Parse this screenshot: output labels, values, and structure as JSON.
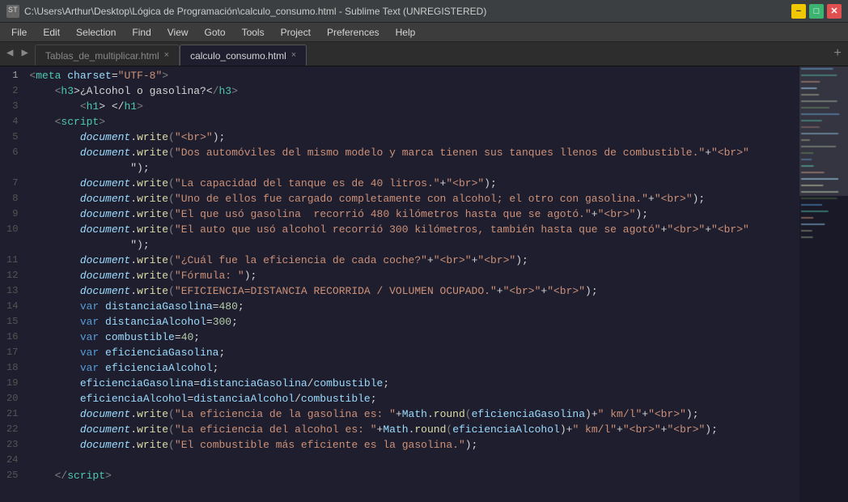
{
  "titleBar": {
    "title": "C:\\Users\\Arthur\\Desktop\\Lógica de Programación\\calculo_consumo.html - Sublime Text (UNREGISTERED)",
    "icon": "ST"
  },
  "menuBar": {
    "items": [
      "File",
      "Edit",
      "Selection",
      "Find",
      "View",
      "Goto",
      "Tools",
      "Project",
      "Preferences",
      "Help"
    ]
  },
  "tabs": [
    {
      "id": "tab1",
      "label": "Tablas_de_multiplicar.html",
      "active": false
    },
    {
      "id": "tab2",
      "label": "calculo_consumo.html",
      "active": true
    }
  ],
  "lines": [
    {
      "num": 1,
      "tokens": [
        {
          "t": "<",
          "c": "c-bracket"
        },
        {
          "t": "meta",
          "c": "c-tagname"
        },
        {
          "t": " charset",
          "c": "c-attr"
        },
        {
          "t": "=",
          "c": "c-op"
        },
        {
          "t": "\"UTF-8\"",
          "c": "c-charsetattrval"
        },
        {
          "t": ">",
          "c": "c-bracket"
        }
      ]
    },
    {
      "num": 2,
      "tokens": [
        {
          "t": "    <",
          "c": "c-bracket"
        },
        {
          "t": "h3",
          "c": "c-tagname"
        },
        {
          "t": ">¿Alcohol o gasolina?<",
          "c": "c-white"
        },
        {
          "t": "/",
          "c": "c-bracket"
        },
        {
          "t": "h3",
          "c": "c-tagname"
        },
        {
          "t": ">",
          "c": "c-bracket"
        }
      ]
    },
    {
      "num": 3,
      "tokens": [
        {
          "t": "        <",
          "c": "c-bracket"
        },
        {
          "t": "h1",
          "c": "c-tagname"
        },
        {
          "t": "> </",
          "c": "c-white"
        },
        {
          "t": "h1",
          "c": "c-tagname"
        },
        {
          "t": ">",
          "c": "c-bracket"
        }
      ]
    },
    {
      "num": 4,
      "tokens": [
        {
          "t": "    <",
          "c": "c-bracket"
        },
        {
          "t": "script",
          "c": "c-tagname"
        },
        {
          "t": ">",
          "c": "c-bracket"
        }
      ]
    },
    {
      "num": 5,
      "tokens": [
        {
          "t": "        ",
          "c": "c-white"
        },
        {
          "t": "document",
          "c": "c-italic"
        },
        {
          "t": ".",
          "c": "c-op"
        },
        {
          "t": "write",
          "c": "c-fn"
        },
        {
          "t": "(",
          "c": "c-bracket"
        },
        {
          "t": "\"<br>\"",
          "c": "c-string"
        },
        {
          "t": ");",
          "c": "c-white"
        }
      ]
    },
    {
      "num": 6,
      "tokens": [
        {
          "t": "        ",
          "c": "c-white"
        },
        {
          "t": "document",
          "c": "c-italic"
        },
        {
          "t": ".",
          "c": "c-op"
        },
        {
          "t": "write",
          "c": "c-fn"
        },
        {
          "t": "(",
          "c": "c-bracket"
        },
        {
          "t": "\"Dos automóviles del mismo modelo y marca tienen sus tanques llenos de combustible.\"",
          "c": "c-string"
        },
        {
          "t": "+",
          "c": "c-op"
        },
        {
          "t": "\"<br>\"",
          "c": "c-string"
        }
      ]
    },
    {
      "num": 6,
      "tokens": [
        {
          "t": "        ",
          "c": "c-white"
        },
        {
          "t": "        \");",
          "c": "c-white"
        }
      ]
    },
    {
      "num": 7,
      "tokens": [
        {
          "t": "        ",
          "c": "c-white"
        },
        {
          "t": "document",
          "c": "c-italic"
        },
        {
          "t": ".",
          "c": "c-op"
        },
        {
          "t": "write",
          "c": "c-fn"
        },
        {
          "t": "(",
          "c": "c-bracket"
        },
        {
          "t": "\"La capacidad del tanque es de 40 litros.\"",
          "c": "c-string"
        },
        {
          "t": "+",
          "c": "c-op"
        },
        {
          "t": "\"<br>\"",
          "c": "c-string"
        },
        {
          "t": ");",
          "c": "c-white"
        }
      ]
    },
    {
      "num": 8,
      "tokens": [
        {
          "t": "        ",
          "c": "c-white"
        },
        {
          "t": "document",
          "c": "c-italic"
        },
        {
          "t": ".",
          "c": "c-op"
        },
        {
          "t": "write",
          "c": "c-fn"
        },
        {
          "t": "(",
          "c": "c-bracket"
        },
        {
          "t": "\"Uno de ellos fue cargado completamente con alcohol; el otro con gasolina.\"",
          "c": "c-string"
        },
        {
          "t": "+",
          "c": "c-op"
        },
        {
          "t": "\"<br>\"",
          "c": "c-string"
        },
        {
          "t": ");",
          "c": "c-white"
        }
      ]
    },
    {
      "num": 9,
      "tokens": [
        {
          "t": "        ",
          "c": "c-white"
        },
        {
          "t": "document",
          "c": "c-italic"
        },
        {
          "t": ".",
          "c": "c-op"
        },
        {
          "t": "write",
          "c": "c-fn"
        },
        {
          "t": "(",
          "c": "c-bracket"
        },
        {
          "t": "\"El que usó gasolina  recorrió 480 kilómetros hasta que se agotó.\"",
          "c": "c-string"
        },
        {
          "t": "+",
          "c": "c-op"
        },
        {
          "t": "\"<br>\"",
          "c": "c-string"
        },
        {
          "t": ");",
          "c": "c-white"
        }
      ]
    },
    {
      "num": 10,
      "tokens": [
        {
          "t": "        ",
          "c": "c-white"
        },
        {
          "t": "document",
          "c": "c-italic"
        },
        {
          "t": ".",
          "c": "c-op"
        },
        {
          "t": "write",
          "c": "c-fn"
        },
        {
          "t": "(",
          "c": "c-bracket"
        },
        {
          "t": "\"El auto que usó alcohol recorrió 300 kilómetros, también hasta que se agotó\"",
          "c": "c-string"
        },
        {
          "t": "+",
          "c": "c-op"
        },
        {
          "t": "\"<br>\"",
          "c": "c-string"
        },
        {
          "t": "+",
          "c": "c-op"
        },
        {
          "t": "\"<br>\"",
          "c": "c-string"
        }
      ]
    },
    {
      "num": 10,
      "tokens": [
        {
          "t": "        ",
          "c": "c-white"
        },
        {
          "t": "        \");",
          "c": "c-white"
        }
      ]
    },
    {
      "num": 11,
      "tokens": [
        {
          "t": "        ",
          "c": "c-white"
        },
        {
          "t": "document",
          "c": "c-italic"
        },
        {
          "t": ".",
          "c": "c-op"
        },
        {
          "t": "write",
          "c": "c-fn"
        },
        {
          "t": "(",
          "c": "c-bracket"
        },
        {
          "t": "\"¿Cuál fue la eficiencia de cada coche?\"",
          "c": "c-string"
        },
        {
          "t": "+",
          "c": "c-op"
        },
        {
          "t": "\"<br>\"",
          "c": "c-string"
        },
        {
          "t": "+",
          "c": "c-op"
        },
        {
          "t": "\"<br>\"",
          "c": "c-string"
        },
        {
          "t": ");",
          "c": "c-white"
        }
      ]
    },
    {
      "num": 12,
      "tokens": [
        {
          "t": "        ",
          "c": "c-white"
        },
        {
          "t": "document",
          "c": "c-italic"
        },
        {
          "t": ".",
          "c": "c-op"
        },
        {
          "t": "write",
          "c": "c-fn"
        },
        {
          "t": "(",
          "c": "c-bracket"
        },
        {
          "t": "\"Fórmula: \"",
          "c": "c-string"
        },
        {
          "t": ");",
          "c": "c-white"
        }
      ]
    },
    {
      "num": 13,
      "tokens": [
        {
          "t": "        ",
          "c": "c-white"
        },
        {
          "t": "document",
          "c": "c-italic"
        },
        {
          "t": ".",
          "c": "c-op"
        },
        {
          "t": "write",
          "c": "c-fn"
        },
        {
          "t": "(",
          "c": "c-bracket"
        },
        {
          "t": "\"EFICIENCIA=DISTANCIA RECORRIDA / VOLUMEN OCUPADO.\"",
          "c": "c-string"
        },
        {
          "t": "+",
          "c": "c-op"
        },
        {
          "t": "\"<br>\"",
          "c": "c-string"
        },
        {
          "t": "+",
          "c": "c-op"
        },
        {
          "t": "\"<br>\"",
          "c": "c-string"
        },
        {
          "t": ");",
          "c": "c-white"
        }
      ]
    },
    {
      "num": 14,
      "tokens": [
        {
          "t": "        ",
          "c": "c-white"
        },
        {
          "t": "var ",
          "c": "c-kw"
        },
        {
          "t": "distanciaGasolina",
          "c": "c-prop"
        },
        {
          "t": "=",
          "c": "c-op"
        },
        {
          "t": "480",
          "c": "c-num"
        },
        {
          "t": ";",
          "c": "c-white"
        }
      ]
    },
    {
      "num": 15,
      "tokens": [
        {
          "t": "        ",
          "c": "c-white"
        },
        {
          "t": "var ",
          "c": "c-kw"
        },
        {
          "t": "distanciaAlcohol",
          "c": "c-prop"
        },
        {
          "t": "=",
          "c": "c-op"
        },
        {
          "t": "300",
          "c": "c-num"
        },
        {
          "t": ";",
          "c": "c-white"
        }
      ]
    },
    {
      "num": 16,
      "tokens": [
        {
          "t": "        ",
          "c": "c-white"
        },
        {
          "t": "var ",
          "c": "c-kw"
        },
        {
          "t": "combustible",
          "c": "c-prop"
        },
        {
          "t": "=",
          "c": "c-op"
        },
        {
          "t": "40",
          "c": "c-num"
        },
        {
          "t": ";",
          "c": "c-white"
        }
      ]
    },
    {
      "num": 17,
      "tokens": [
        {
          "t": "        ",
          "c": "c-white"
        },
        {
          "t": "var ",
          "c": "c-kw"
        },
        {
          "t": "eficienciaGasolina",
          "c": "c-prop"
        },
        {
          "t": ";",
          "c": "c-white"
        }
      ]
    },
    {
      "num": 18,
      "tokens": [
        {
          "t": "        ",
          "c": "c-white"
        },
        {
          "t": "var ",
          "c": "c-kw"
        },
        {
          "t": "eficienciaAlcohol",
          "c": "c-prop"
        },
        {
          "t": ";",
          "c": "c-white"
        }
      ]
    },
    {
      "num": 19,
      "tokens": [
        {
          "t": "        ",
          "c": "c-white"
        },
        {
          "t": "eficienciaGasolina",
          "c": "c-prop"
        },
        {
          "t": "=",
          "c": "c-op"
        },
        {
          "t": "distanciaGasolina",
          "c": "c-prop"
        },
        {
          "t": "/",
          "c": "c-op"
        },
        {
          "t": "combustible",
          "c": "c-prop"
        },
        {
          "t": ";",
          "c": "c-white"
        }
      ]
    },
    {
      "num": 20,
      "tokens": [
        {
          "t": "        ",
          "c": "c-white"
        },
        {
          "t": "eficienciaAlcohol",
          "c": "c-prop"
        },
        {
          "t": "=",
          "c": "c-op"
        },
        {
          "t": "distanciaAlcohol",
          "c": "c-prop"
        },
        {
          "t": "/",
          "c": "c-op"
        },
        {
          "t": "combustible",
          "c": "c-prop"
        },
        {
          "t": ";",
          "c": "c-white"
        }
      ]
    },
    {
      "num": 21,
      "tokens": [
        {
          "t": "        ",
          "c": "c-white"
        },
        {
          "t": "document",
          "c": "c-italic"
        },
        {
          "t": ".",
          "c": "c-op"
        },
        {
          "t": "write",
          "c": "c-fn"
        },
        {
          "t": "(",
          "c": "c-bracket"
        },
        {
          "t": "\"La eficiencia de la gasolina es: \"",
          "c": "c-string"
        },
        {
          "t": "+",
          "c": "c-op"
        },
        {
          "t": "Math",
          "c": "c-prop"
        },
        {
          "t": ".",
          "c": "c-op"
        },
        {
          "t": "round",
          "c": "c-fn"
        },
        {
          "t": "(",
          "c": "c-bracket"
        },
        {
          "t": "eficienciaGasolina",
          "c": "c-prop"
        },
        {
          "t": ")+",
          "c": "c-white"
        },
        {
          "t": "\" km/l\"",
          "c": "c-string"
        },
        {
          "t": "+",
          "c": "c-op"
        },
        {
          "t": "\"<br>\"",
          "c": "c-string"
        },
        {
          "t": ");",
          "c": "c-white"
        }
      ]
    },
    {
      "num": 22,
      "tokens": [
        {
          "t": "        ",
          "c": "c-white"
        },
        {
          "t": "document",
          "c": "c-italic"
        },
        {
          "t": ".",
          "c": "c-op"
        },
        {
          "t": "write",
          "c": "c-fn"
        },
        {
          "t": "(",
          "c": "c-bracket"
        },
        {
          "t": "\"La eficiencia del alcohol es: \"",
          "c": "c-string"
        },
        {
          "t": "+",
          "c": "c-op"
        },
        {
          "t": "Math",
          "c": "c-prop"
        },
        {
          "t": ".",
          "c": "c-op"
        },
        {
          "t": "round",
          "c": "c-fn"
        },
        {
          "t": "(",
          "c": "c-bracket"
        },
        {
          "t": "eficienciaAlcohol",
          "c": "c-prop"
        },
        {
          "t": ")+",
          "c": "c-white"
        },
        {
          "t": "\" km/l\"",
          "c": "c-string"
        },
        {
          "t": "+",
          "c": "c-op"
        },
        {
          "t": "\"<br>\"",
          "c": "c-string"
        },
        {
          "t": "+",
          "c": "c-op"
        },
        {
          "t": "\"<br>\"",
          "c": "c-string"
        },
        {
          "t": ");",
          "c": "c-white"
        }
      ]
    },
    {
      "num": 23,
      "tokens": [
        {
          "t": "        ",
          "c": "c-white"
        },
        {
          "t": "document",
          "c": "c-italic"
        },
        {
          "t": ".",
          "c": "c-op"
        },
        {
          "t": "write",
          "c": "c-fn"
        },
        {
          "t": "(",
          "c": "c-bracket"
        },
        {
          "t": "\"El combustible más eficiente es la gasolina.\"",
          "c": "c-string"
        },
        {
          "t": ");",
          "c": "c-white"
        }
      ]
    },
    {
      "num": 24,
      "tokens": []
    },
    {
      "num": 25,
      "tokens": [
        {
          "t": "    </",
          "c": "c-bracket"
        },
        {
          "t": "script",
          "c": "c-tagname"
        },
        {
          "t": ">",
          "c": "c-bracket"
        }
      ]
    }
  ],
  "buttons": {
    "minimize": "−",
    "maximize": "□",
    "close": "✕"
  }
}
